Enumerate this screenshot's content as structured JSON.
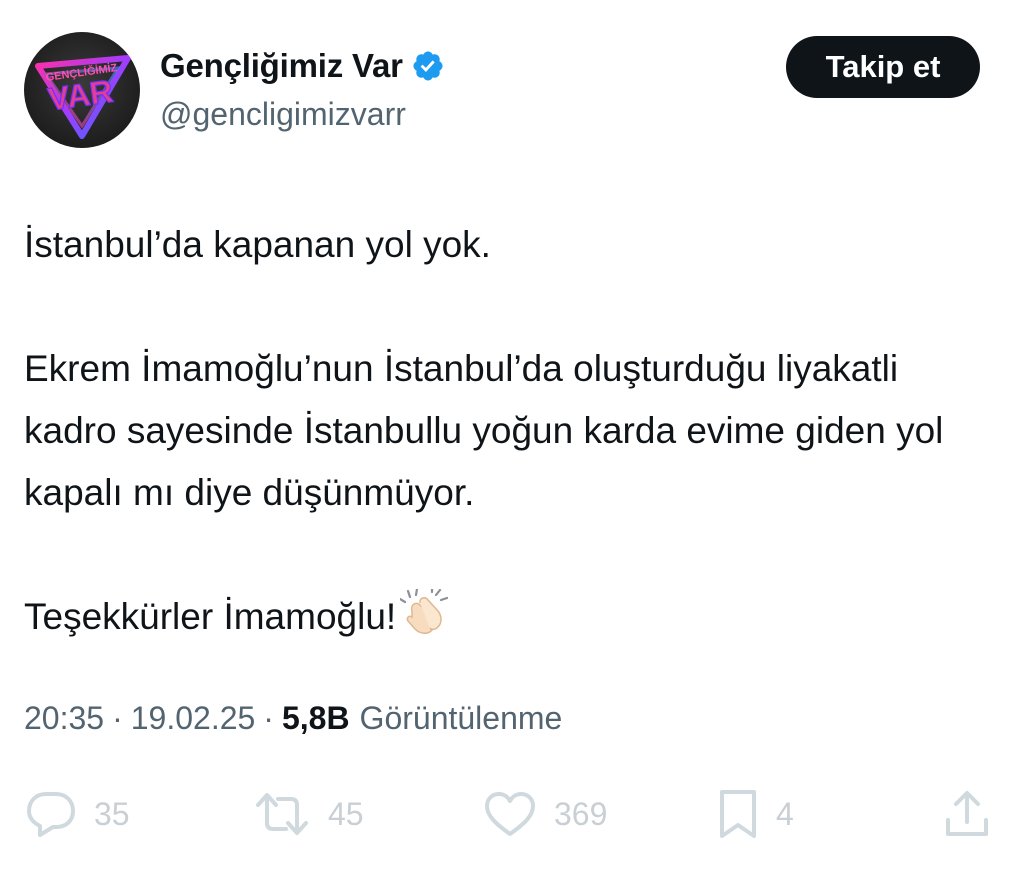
{
  "author": {
    "display_name": "Gençliğimiz Var",
    "handle": "@gencligimizvarr",
    "verified": true,
    "avatar_icon": "genclik-var-logo",
    "avatar_text_top": "GENÇLİĞİMİZ",
    "avatar_text_main": "VAR"
  },
  "follow_button": {
    "label": "Takip et"
  },
  "tweet": {
    "line1": "İstanbul’da kapanan yol yok.",
    "paragraph2": "Ekrem İmamoğlu’nun İstanbul’da oluşturduğu liyakatli kadro sayesinde İstanbullu yoğun karda evime giden yol kapalı mı diye düşünmüyor.",
    "line3": "Teşekkürler İmamoğlu!",
    "emoji": "clapping-hands"
  },
  "meta": {
    "time": "20:35",
    "date": "19.02.25",
    "separator": "·",
    "views_count": "5,8B",
    "views_label": "Görüntülenme"
  },
  "actions": {
    "replies": "35",
    "reposts": "45",
    "likes": "369",
    "bookmarks": "4"
  },
  "colors": {
    "text": "#0f1419",
    "muted": "#536471",
    "verified": "#1d9bf0",
    "button_bg": "#0f1419",
    "action_gray": "#cfd9de"
  }
}
